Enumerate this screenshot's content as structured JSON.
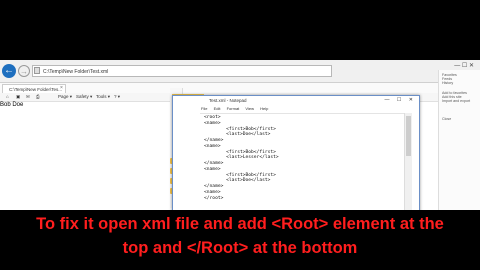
{
  "browser": {
    "url": "C:\\Temp\\New Folder\\Test.xml",
    "tab_title": "C:\\Temp\\New Folder\\Tes...",
    "window_controls": "— ☐ ✕",
    "command_bar": {
      "page": "Page ▾",
      "safety": "Safety ▾",
      "tools": "Tools ▾",
      "help": "? ▾"
    },
    "page_text": "Bob Doe"
  },
  "notepad": {
    "title": "Test.xml - Notepad",
    "controls": "— ☐ ✕",
    "menu": [
      "File",
      "Edit",
      "Format",
      "View",
      "Help"
    ],
    "content": "<root>\n<name>\n        <first>Bob</first>\n        <last>Doe</last>\n</name>\n<name>\n        <first>Bob</first>\n        <last>Lesser</last>\n</name>\n<name>\n        <first>Bob</first>\n        <last>Doe</last>\n</name>\n<name>\n</root>"
  },
  "right_pane": {
    "items": [
      "Favorites",
      "Feeds",
      "History",
      "Add to favorites",
      "Add this site",
      "Import and export",
      "Close"
    ]
  },
  "caption": {
    "line1": "To fix it open xml file and add <Root> element at the",
    "line2": "top and </Root> at the bottom"
  },
  "colors": {
    "caption": "#ff1e1e",
    "background": "#000000",
    "back_button": "#1e6fbf"
  }
}
